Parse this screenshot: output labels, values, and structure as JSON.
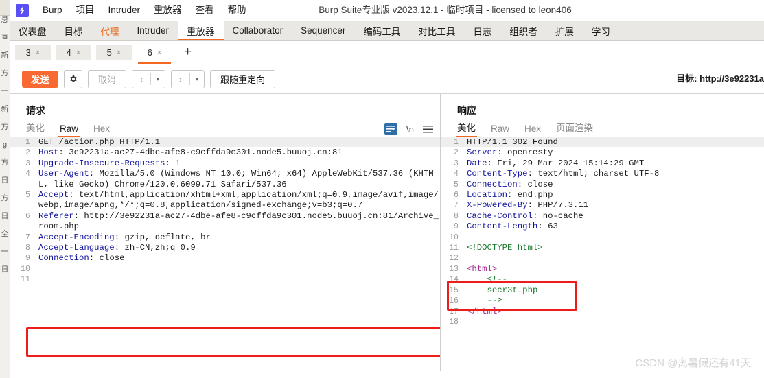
{
  "window": {
    "title": "Burp Suite专业版  v2023.12.1 - 临时项目 - licensed to leon406",
    "logo_icon": "burp-lightning-icon"
  },
  "menubar": {
    "items": [
      {
        "label": "Burp"
      },
      {
        "label": "项目"
      },
      {
        "label": "Intruder"
      },
      {
        "label": "重放器"
      },
      {
        "label": "查看"
      },
      {
        "label": "帮助"
      }
    ]
  },
  "top_tabs": {
    "items": [
      {
        "label": "仪表盘",
        "active": false
      },
      {
        "label": "目标",
        "active": false
      },
      {
        "label": "代理",
        "active": false
      },
      {
        "label": "Intruder",
        "active": false
      },
      {
        "label": "重放器",
        "active": true
      },
      {
        "label": "Collaborator",
        "active": false
      },
      {
        "label": "Sequencer",
        "active": false
      },
      {
        "label": "编码工具",
        "active": false
      },
      {
        "label": "对比工具",
        "active": false
      },
      {
        "label": "日志",
        "active": false
      },
      {
        "label": "组织者",
        "active": false
      },
      {
        "label": "扩展",
        "active": false
      },
      {
        "label": "学习",
        "active": false
      }
    ],
    "accent": "#f26722",
    "proxy_color": "#e8732a"
  },
  "repeater_tabs": {
    "items": [
      {
        "label": "3",
        "close": "×",
        "active": false
      },
      {
        "label": "4",
        "close": "×",
        "active": false
      },
      {
        "label": "5",
        "close": "×",
        "active": false
      },
      {
        "label": "6",
        "close": "×",
        "active": true
      }
    ],
    "add_label": "+"
  },
  "toolbar": {
    "send_label": "发送",
    "settings_icon": "gear-icon",
    "cancel_label": "取消",
    "back_arrow": "‹",
    "forward_arrow": "›",
    "caret": "▾",
    "follow_redirect_label": "跟随重定向",
    "target_label": "目标: http://3e92231a",
    "send_color": "#f96a32"
  },
  "request": {
    "title": "请求",
    "tabs": [
      {
        "label": "美化",
        "active": false
      },
      {
        "label": "Raw",
        "active": true
      },
      {
        "label": "Hex",
        "active": false
      }
    ],
    "icons": {
      "wrap": "word-wrap-icon",
      "newline": "\\n",
      "menu": "hamburger-menu-icon"
    },
    "lines": [
      {
        "n": "1",
        "highlight": true,
        "parts": [
          {
            "t": "GET /action.php HTTP/1.1",
            "c": "hv"
          }
        ]
      },
      {
        "n": "2",
        "parts": [
          {
            "t": "Host",
            "c": "hk"
          },
          {
            "t": ": 3e92231a-ac27-4dbe-afe8-c9cffda9c301.node5.buuoj.cn:81",
            "c": "hv"
          }
        ]
      },
      {
        "n": "3",
        "parts": [
          {
            "t": "Upgrade-Insecure-Requests",
            "c": "hk"
          },
          {
            "t": ": 1",
            "c": "hv"
          }
        ]
      },
      {
        "n": "4",
        "parts": [
          {
            "t": "User-Agent",
            "c": "hk"
          },
          {
            "t": ": Mozilla/5.0 (Windows NT 10.0; Win64; x64) AppleWebKit/537.36 (KHTML, like Gecko) Chrome/120.0.6099.71 Safari/537.36",
            "c": "hv"
          }
        ]
      },
      {
        "n": "5",
        "parts": [
          {
            "t": "Accept",
            "c": "hk"
          },
          {
            "t": ": text/html,application/xhtml+xml,application/xml;q=0.9,image/avif,image/webp,image/apng,*/*;q=0.8,application/signed-exchange;v=b3;q=0.7",
            "c": "hv"
          }
        ]
      },
      {
        "n": "6",
        "parts": [
          {
            "t": "Referer",
            "c": "hk"
          },
          {
            "t": ": http://3e92231a-ac27-4dbe-afe8-c9cffda9c301.node5.buuoj.cn:81/Archive_room.php",
            "c": "hv"
          }
        ]
      },
      {
        "n": "7",
        "parts": [
          {
            "t": "Accept-Encoding",
            "c": "hk"
          },
          {
            "t": ": gzip, deflate, br",
            "c": "hv"
          }
        ]
      },
      {
        "n": "8",
        "parts": [
          {
            "t": "Accept-Language",
            "c": "hk"
          },
          {
            "t": ": zh-CN,zh;q=0.9",
            "c": "hv"
          }
        ]
      },
      {
        "n": "9",
        "parts": [
          {
            "t": "Connection",
            "c": "hk"
          },
          {
            "t": ": close",
            "c": "hv"
          }
        ]
      },
      {
        "n": "10",
        "parts": [
          {
            "t": "",
            "c": "hv"
          }
        ]
      },
      {
        "n": "11",
        "parts": [
          {
            "t": "",
            "c": "hv"
          }
        ]
      }
    ]
  },
  "response": {
    "title": "响应",
    "tabs": [
      {
        "label": "美化",
        "active": true
      },
      {
        "label": "Raw",
        "active": false
      },
      {
        "label": "Hex",
        "active": false
      },
      {
        "label": "页面渲染",
        "active": false
      }
    ],
    "lines": [
      {
        "n": "1",
        "highlight": true,
        "parts": [
          {
            "t": "HTTP/1.1 302 Found",
            "c": "hv"
          }
        ]
      },
      {
        "n": "2",
        "parts": [
          {
            "t": "Server",
            "c": "hk"
          },
          {
            "t": ": openresty",
            "c": "hv"
          }
        ]
      },
      {
        "n": "3",
        "parts": [
          {
            "t": "Date",
            "c": "hk"
          },
          {
            "t": ": Fri, 29 Mar 2024 15:14:29 GMT",
            "c": "hv"
          }
        ]
      },
      {
        "n": "4",
        "parts": [
          {
            "t": "Content-Type",
            "c": "hk"
          },
          {
            "t": ": text/html; charset=UTF-8",
            "c": "hv"
          }
        ]
      },
      {
        "n": "5",
        "parts": [
          {
            "t": "Connection",
            "c": "hk"
          },
          {
            "t": ": close",
            "c": "hv"
          }
        ]
      },
      {
        "n": "6",
        "parts": [
          {
            "t": "Location",
            "c": "hk"
          },
          {
            "t": ": end.php",
            "c": "hv"
          }
        ]
      },
      {
        "n": "7",
        "parts": [
          {
            "t": "X-Powered-By",
            "c": "hk"
          },
          {
            "t": ": PHP/7.3.11",
            "c": "hv"
          }
        ]
      },
      {
        "n": "8",
        "parts": [
          {
            "t": "Cache-Control",
            "c": "hk"
          },
          {
            "t": ": no-cache",
            "c": "hv"
          }
        ]
      },
      {
        "n": "9",
        "parts": [
          {
            "t": "Content-Length",
            "c": "hk"
          },
          {
            "t": ": 63",
            "c": "hv"
          }
        ]
      },
      {
        "n": "10",
        "parts": [
          {
            "t": "",
            "c": "hv"
          }
        ]
      },
      {
        "n": "11",
        "parts": [
          {
            "t": "<!DOCTYPE html>",
            "c": "cmt"
          }
        ]
      },
      {
        "n": "12",
        "parts": [
          {
            "t": "",
            "c": "hv"
          }
        ]
      },
      {
        "n": "13",
        "parts": [
          {
            "t": "<html>",
            "c": "tagc"
          }
        ]
      },
      {
        "n": "14",
        "parts": [
          {
            "t": "    <!--",
            "c": "cmt"
          }
        ]
      },
      {
        "n": "15",
        "parts": [
          {
            "t": "    secr3t.php",
            "c": "cmt"
          }
        ]
      },
      {
        "n": "16",
        "parts": [
          {
            "t": "    -->",
            "c": "cmt"
          }
        ]
      },
      {
        "n": "17",
        "parts": [
          {
            "t": "</html>",
            "c": "tagc"
          }
        ]
      },
      {
        "n": "18",
        "parts": [
          {
            "t": "",
            "c": "hv"
          }
        ]
      }
    ]
  },
  "annotations": {
    "referer_box": "red-highlight-box",
    "secret_box": "red-highlight-box",
    "color": "#ef1c1c"
  },
  "watermark": {
    "text": "CSDN @离暑假还有41天"
  },
  "background_window": {
    "chars": [
      "息",
      "亘",
      "新",
      "方",
      "一",
      "新",
      "方",
      "g",
      "方",
      "日",
      "方",
      "日",
      "全",
      "一",
      "日"
    ]
  }
}
